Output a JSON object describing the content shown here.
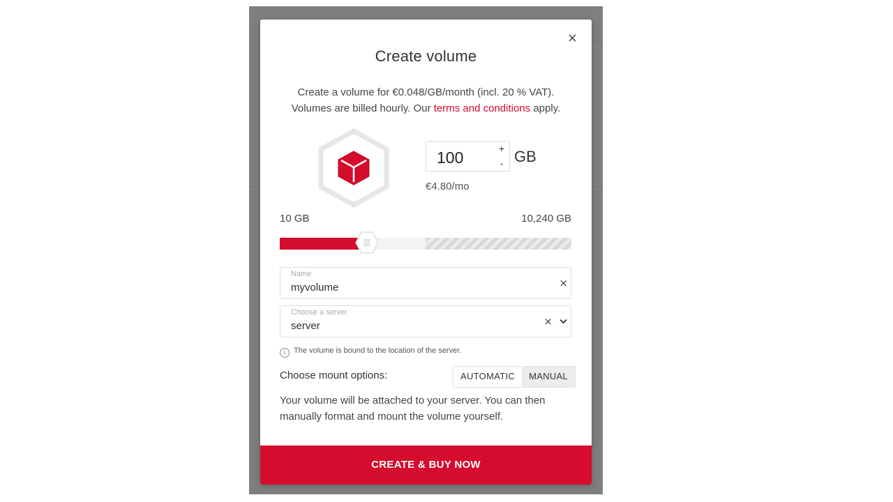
{
  "modal": {
    "title": "Create volume",
    "intro_line1": "Create a volume for €0.048/GB/month (incl. 20 % VAT).",
    "intro_line2_prefix": "Volumes are billed hourly. Our",
    "terms_link": "terms and conditions",
    "intro_line2_suffix": "apply.",
    "close_glyph": "×"
  },
  "size": {
    "value": "100",
    "unit": "GB",
    "plus": "+",
    "minus": "-",
    "price": "€4.80/mo"
  },
  "slider": {
    "min_label": "10 GB",
    "max_label": "10,240 GB",
    "level": 0.3
  },
  "name_field": {
    "label": "Name",
    "value": "myvolume",
    "clear_glyph": "×"
  },
  "server_field": {
    "label": "Choose a server",
    "value": "server",
    "clear_glyph": "×",
    "chevron": "⌄"
  },
  "info": {
    "text": "The volume is bound to the location of the server."
  },
  "mount": {
    "label": "Choose mount options:",
    "options": [
      "AUTOMATIC",
      "MANUAL"
    ],
    "selected": "MANUAL",
    "description": "Your volume will be attached to your server. You can then manually format and mount the volume yourself."
  },
  "cta": {
    "label": "CREATE & BUY NOW"
  },
  "colors": {
    "accent": "#d50c2d",
    "backdrop": "#7f7f7f"
  },
  "icons": {
    "volume": "volume-cube-icon",
    "info": "info-icon",
    "close": "close-icon"
  }
}
